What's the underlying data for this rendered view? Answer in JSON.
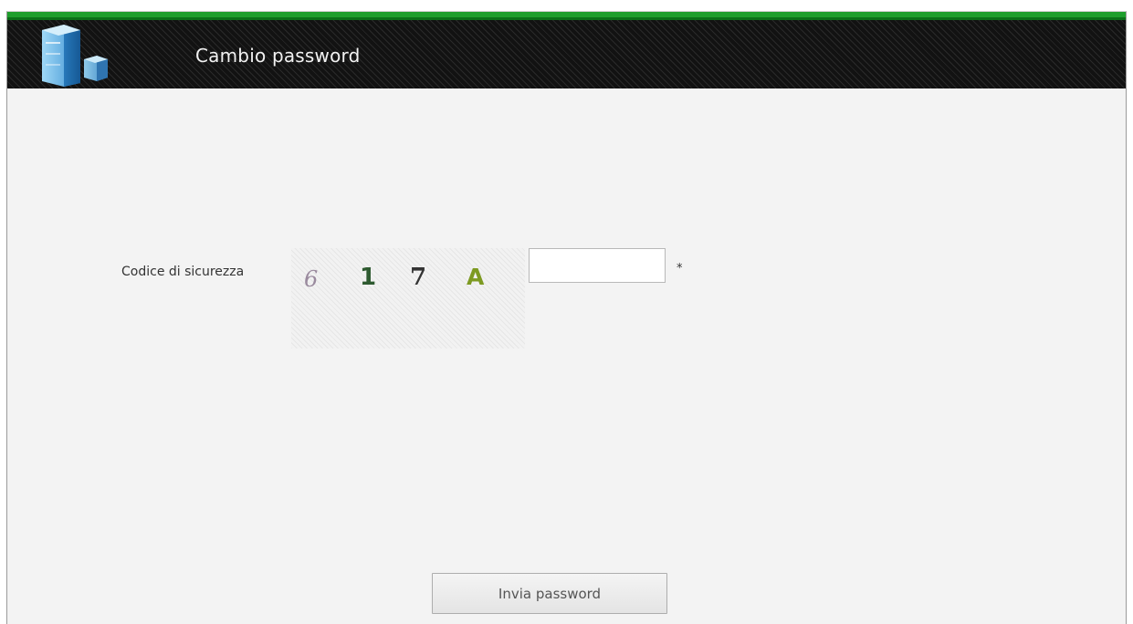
{
  "header": {
    "title": "Cambio password",
    "logo_icon": "server-cubes-logo-icon",
    "accent_color": "#1e9e2c"
  },
  "form": {
    "security_code_label": "Codice di sicurezza",
    "captcha": {
      "icon": "captcha-image",
      "chars": [
        "6",
        "1",
        "7",
        "A"
      ]
    },
    "code_input_value": "",
    "required_marker": "*",
    "submit_label": "Invia password"
  }
}
